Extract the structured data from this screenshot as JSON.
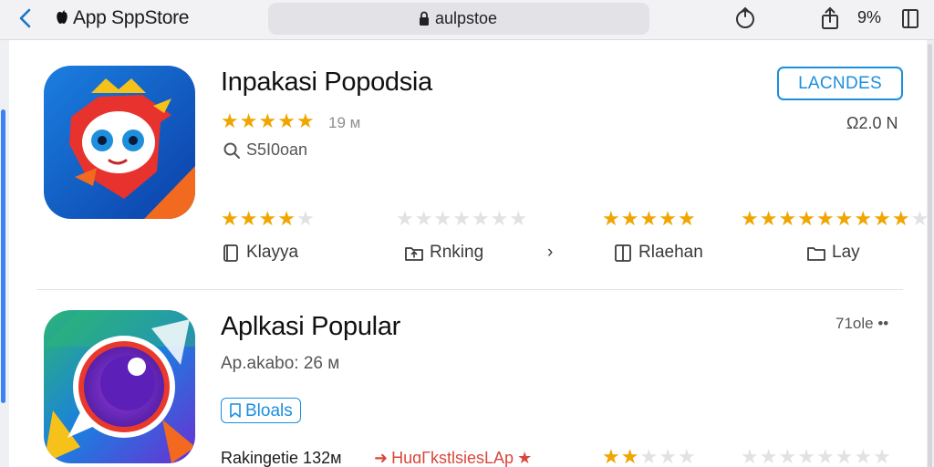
{
  "browser": {
    "brand": "App SppStore",
    "url": "aulpstoe",
    "battery": "9%"
  },
  "apps": [
    {
      "title": "Inpakasi Popodsia",
      "install_label": "LACNDES",
      "rating": 5,
      "rating_count": "19 м",
      "size": "Ω2.0 Ν",
      "search_meta": "S5I0oan",
      "category_ratings": [
        {
          "on": 4,
          "total": 5
        },
        {
          "on": 0,
          "total": 7
        },
        {
          "on": 5,
          "total": 5
        },
        {
          "on": 9,
          "total": 10
        }
      ],
      "categories": [
        {
          "label": "Klayya",
          "icon": "book-icon"
        },
        {
          "label": "Rnking",
          "icon": "folder-up-icon"
        },
        {
          "label": "›",
          "icon": "chevron-right-icon"
        },
        {
          "label": "Rlaehan",
          "icon": "book-open-icon"
        },
        {
          "label": "Lay",
          "icon": "folder-icon"
        }
      ]
    },
    {
      "title": "Aplkasi Popular",
      "right_meta": "71ole ••",
      "sub": "Ap.akabo: 26 м",
      "badge": "Bloals",
      "ranking": "Rakingetie 132м",
      "promo": "HuɑΓkstlsiesLAp",
      "bottom_ratings": [
        {
          "on": 2,
          "total": 5
        },
        {
          "on": 0,
          "total": 8
        }
      ]
    }
  ],
  "colors": {
    "accent": "#1a8fdf",
    "star": "#f0a500",
    "promo": "#d9463b"
  }
}
